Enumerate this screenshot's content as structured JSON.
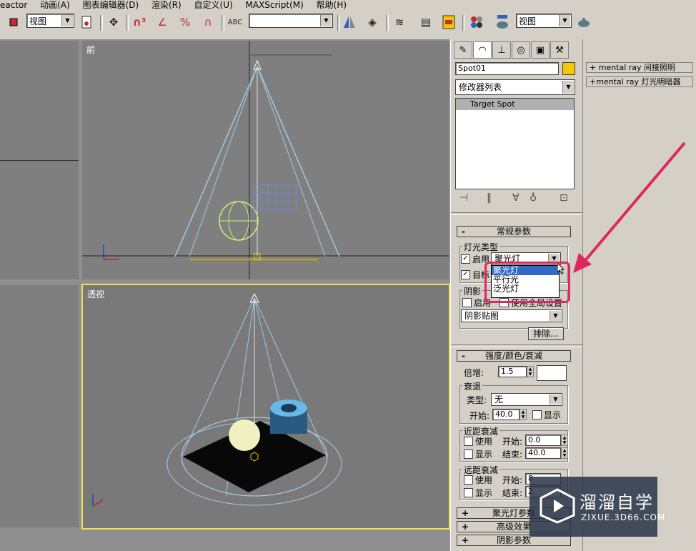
{
  "menubar": [
    "eactor",
    "动画(A)",
    "图表编辑器(D)",
    "渲染(R)",
    "自定义(U)",
    "MAXScript(M)",
    "帮助(H)"
  ],
  "toolbar": {
    "view_combo_1": "视图",
    "view_combo_2": "视图",
    "selection_set_combo": ""
  },
  "viewports": {
    "front_label": "前",
    "perspective_label": "透视",
    "perspective_border_color": "#f0e050"
  },
  "panel": {
    "object_name": "Spot01",
    "object_color": "#f5c800",
    "modifier_list": "修改器列表",
    "stack_item": "Target Spot",
    "general_params": {
      "title": "常规参数",
      "light_type_group": "灯光类型",
      "enable_label": "启用",
      "enable_checked": "✓",
      "light_type_value": "聚光灯",
      "target_label": "目标",
      "target_checked": "✓",
      "shadow_group": "阴影",
      "shadow_enable_label": "启用",
      "use_global_label": "使用全局设置",
      "shadow_type": "阴影贴图",
      "exclude_button": "排除..."
    },
    "intensity": {
      "title": "强度/颜色/衰减",
      "multiplier_label": "倍增:",
      "multiplier_value": "1.5",
      "decay_group": "衰退",
      "type_label": "类型:",
      "type_value": "无",
      "start_label": "开始:",
      "start_value": "40.0",
      "show_label": "显示",
      "near_group": "近距衰减",
      "near_use": "使用",
      "near_start_label": "开始:",
      "near_start_value": "0.0",
      "near_show": "显示",
      "near_end_label": "结束:",
      "near_end_value": "40.0",
      "far_group": "远距衰减",
      "far_use": "使用",
      "far_start_label": "开始:",
      "far_start_value": "8",
      "far_show": "显示",
      "far_end_label": "结束:",
      "far_end_value": "2"
    },
    "collapsed_rollups": [
      "聚光灯参数",
      "高级效果",
      "阴影参数"
    ]
  },
  "popup_options": [
    "聚光灯",
    "平行光",
    "泛光灯"
  ],
  "far_right_rollups": [
    "mental ray 间接照明",
    "mental ray 灯光明暗器"
  ],
  "watermark": {
    "title": "溜溜自学",
    "url": "ZIXUE.3D66.COM"
  }
}
